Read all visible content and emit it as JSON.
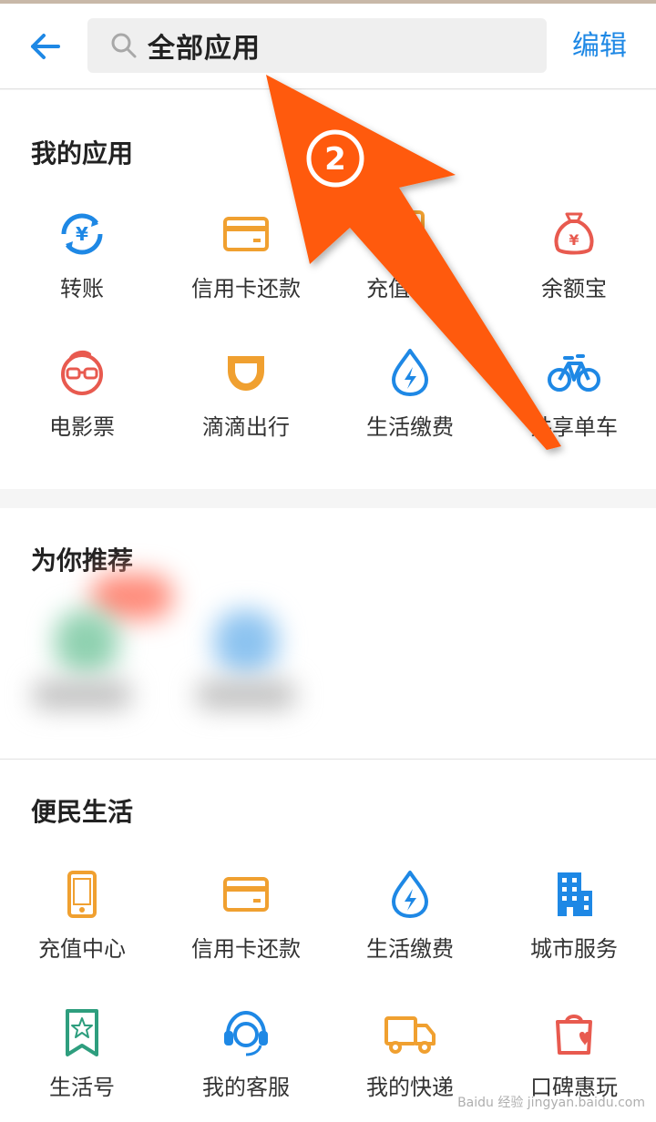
{
  "header": {
    "search_text": "全部应用",
    "edit_label": "编辑"
  },
  "my_apps": {
    "title": "我的应用",
    "items": [
      {
        "label": "转账",
        "icon": "transfer-icon",
        "color": "#1e88e5"
      },
      {
        "label": "信用卡还款",
        "icon": "credit-card-icon",
        "color": "#f0a030"
      },
      {
        "label": "充值中心",
        "icon": "recharge-icon",
        "color": "#f0a030"
      },
      {
        "label": "余额宝",
        "icon": "money-bag-icon",
        "color": "#e85a4f"
      },
      {
        "label": "电影票",
        "icon": "movie-face-icon",
        "color": "#e85a4f"
      },
      {
        "label": "滴滴出行",
        "icon": "didi-icon",
        "color": "#f0a030"
      },
      {
        "label": "生活缴费",
        "icon": "water-drop-icon",
        "color": "#1e88e5"
      },
      {
        "label": "共享单车",
        "icon": "bicycle-icon",
        "color": "#1e88e5"
      }
    ]
  },
  "recommend": {
    "title": "为你推荐"
  },
  "convenience": {
    "title": "便民生活",
    "items": [
      {
        "label": "充值中心",
        "icon": "phone-icon",
        "color": "#f0a030"
      },
      {
        "label": "信用卡还款",
        "icon": "credit-card-icon",
        "color": "#f0a030"
      },
      {
        "label": "生活缴费",
        "icon": "water-drop-icon",
        "color": "#1e88e5"
      },
      {
        "label": "城市服务",
        "icon": "building-icon",
        "color": "#1e88e5"
      },
      {
        "label": "生活号",
        "icon": "bookmark-star-icon",
        "color": "#2e9e7e"
      },
      {
        "label": "我的客服",
        "icon": "headset-icon",
        "color": "#1e88e5"
      },
      {
        "label": "我的快递",
        "icon": "truck-icon",
        "color": "#f0a030"
      },
      {
        "label": "口碑惠玩",
        "icon": "shopping-bag-icon",
        "color": "#e85a4f"
      }
    ]
  },
  "annotation": {
    "step_label": "2",
    "arrow_color": "#ff5a0a"
  },
  "watermark": "Baidu 经验 jingyan.baidu.com"
}
